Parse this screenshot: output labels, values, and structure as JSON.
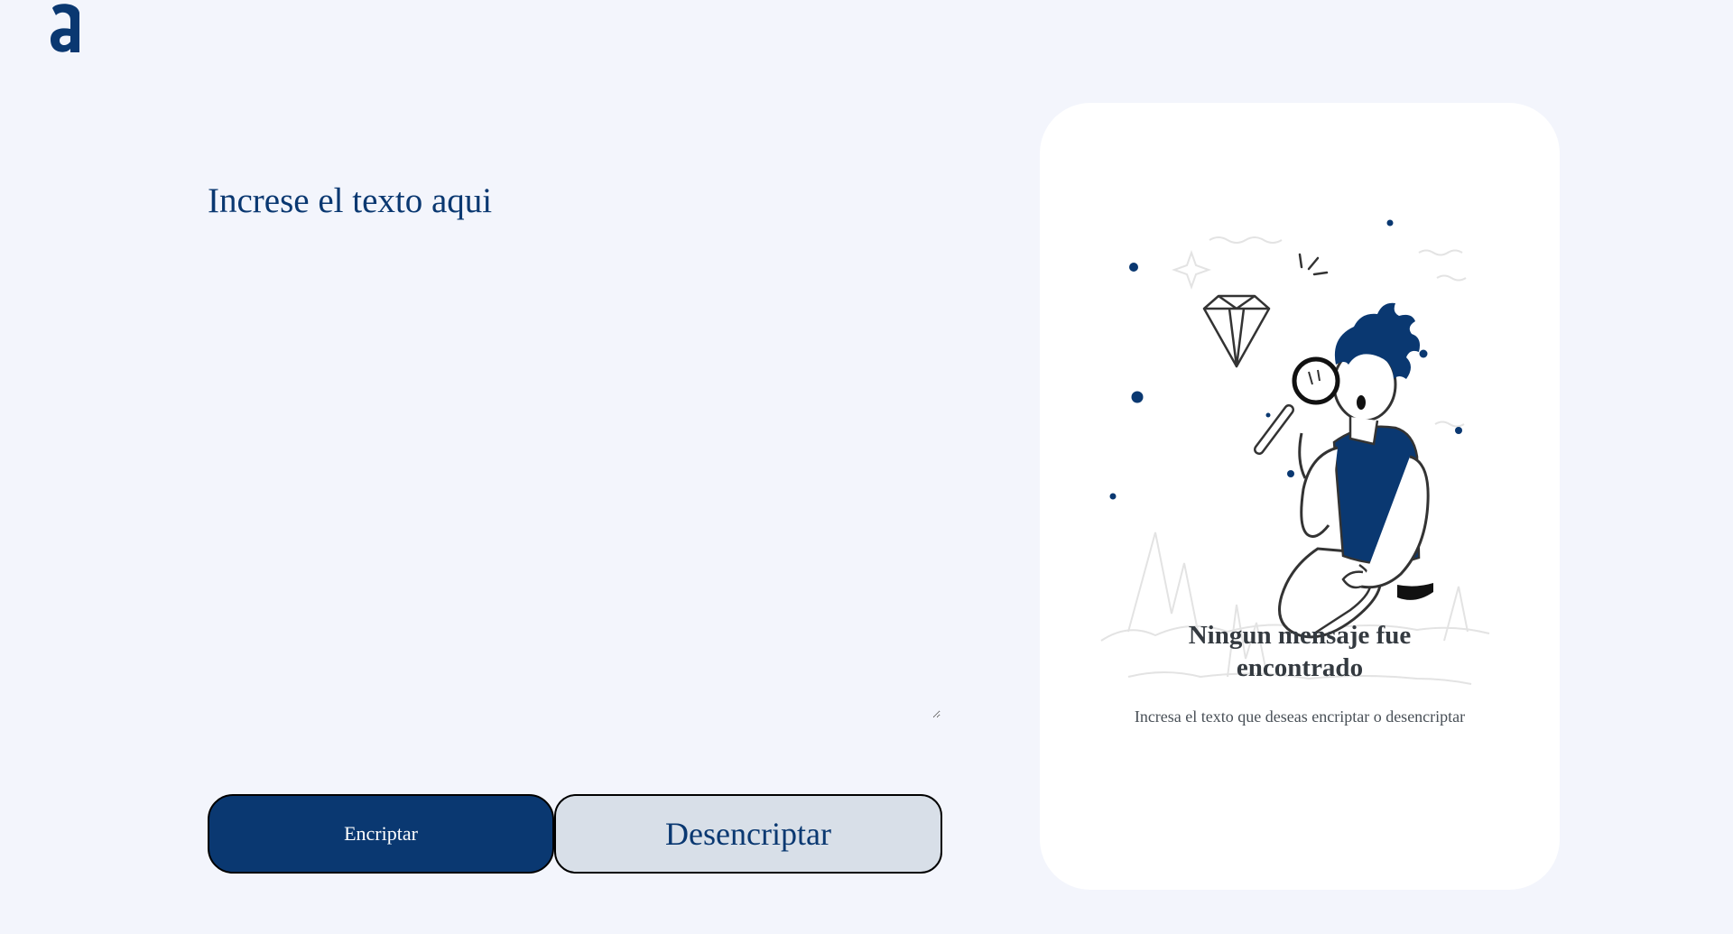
{
  "logo": {
    "icon": "alura-logo-icon",
    "color": "#0a3871"
  },
  "input": {
    "placeholder": "Increse el texto aqui",
    "value": ""
  },
  "buttons": {
    "encrypt_label": "Encriptar",
    "decrypt_label": "Desencriptar"
  },
  "output_panel": {
    "illustration": "person-searching-with-magnifying-glass-icon",
    "title": "Ningun mensaje fue encontrado",
    "subtitle": "Incresa el texto que deseas encriptar o desencriptar"
  },
  "colors": {
    "background": "#f3f5fc",
    "primary": "#0a3871",
    "secondary_button": "#d8dfe8",
    "panel": "#ffffff",
    "panel_title": "#343a40",
    "panel_text": "#495057"
  }
}
